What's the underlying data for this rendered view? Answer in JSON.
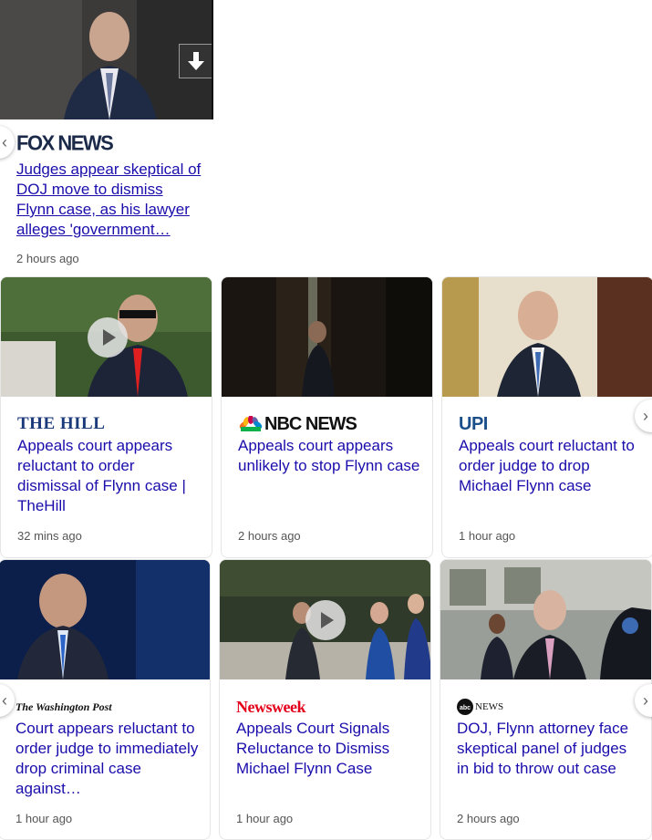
{
  "cards": [
    {
      "source": "FOX NEWS",
      "title": "Judges appear skeptical of DOJ move to dismiss Flynn case, as his lawyer alleges 'government…",
      "time": "2 hours ago"
    },
    {
      "source": "THE HILL",
      "title": "Appeals court appears reluctant to order dismissal of Flynn case | TheHill",
      "time": "32 mins ago"
    },
    {
      "source": "NBC NEWS",
      "title": "Appeals court appears unlikely to stop Flynn case",
      "time": "2 hours ago"
    },
    {
      "source": "UPI",
      "title": "Appeals court reluctant to order judge to drop Michael Flynn case",
      "time": "1 hour ago"
    },
    {
      "source": "The Washington Post",
      "title": "Court appears reluctant to order judge to immediately drop criminal case against…",
      "time": "1 hour ago"
    },
    {
      "source": "Newsweek",
      "title": "Appeals Court Signals Reluctance to Dismiss Michael Flynn Case",
      "time": "1 hour ago"
    },
    {
      "source": "NEWS",
      "title": "DOJ, Flynn attorney face skeptical panel of judges in bid to throw out case",
      "time": "2 hours ago"
    }
  ],
  "icons": {
    "download": "download-arrow-icon",
    "play": "play-icon",
    "prev": "chevron-left-icon",
    "next": "chevron-right-icon",
    "abc": "abc-logo-icon",
    "peacock": "nbc-peacock-icon"
  },
  "colors": {
    "link": "#1a0dab",
    "time": "#555555",
    "hill": "#1b3a7a",
    "upi": "#1a4f8a",
    "newsweek": "#e4001b"
  }
}
